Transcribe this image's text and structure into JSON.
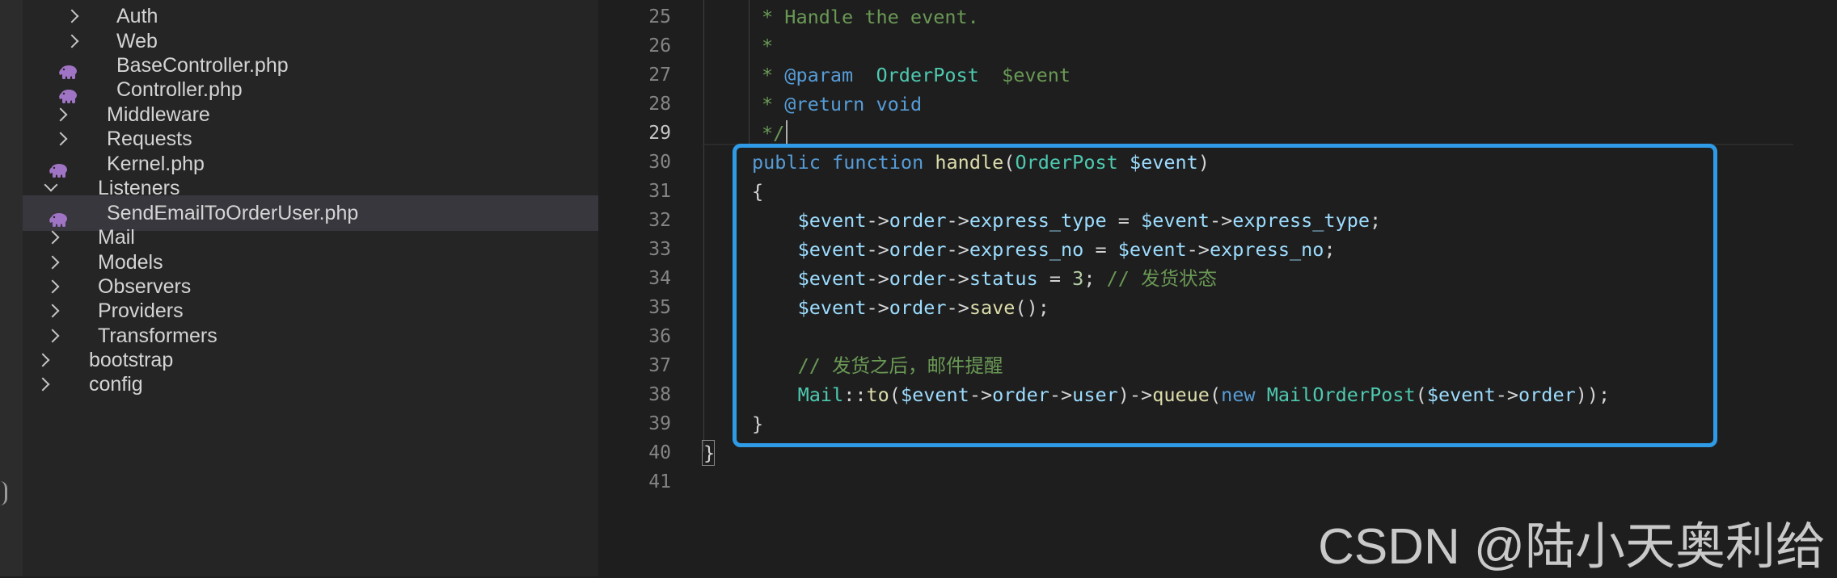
{
  "explorer": {
    "items": [
      {
        "label": "Auth",
        "kind": "folder",
        "state": "closed"
      },
      {
        "label": "Web",
        "kind": "folder",
        "state": "closed"
      },
      {
        "label": "BaseController.php",
        "kind": "php-file"
      },
      {
        "label": "Controller.php",
        "kind": "php-file"
      },
      {
        "label": "Middleware",
        "kind": "folder",
        "state": "closed"
      },
      {
        "label": "Requests",
        "kind": "folder",
        "state": "closed"
      },
      {
        "label": "Kernel.php",
        "kind": "php-file"
      },
      {
        "label": "Listeners",
        "kind": "folder",
        "state": "open"
      },
      {
        "label": "SendEmailToOrderUser.php",
        "kind": "php-file",
        "selected": true
      },
      {
        "label": "Mail",
        "kind": "folder",
        "state": "closed"
      },
      {
        "label": "Models",
        "kind": "folder",
        "state": "closed"
      },
      {
        "label": "Observers",
        "kind": "folder",
        "state": "closed"
      },
      {
        "label": "Providers",
        "kind": "folder",
        "state": "closed"
      },
      {
        "label": "Transformers",
        "kind": "folder",
        "state": "closed"
      },
      {
        "label": "bootstrap",
        "kind": "folder",
        "state": "closed"
      },
      {
        "label": "config",
        "kind": "folder",
        "state": "closed"
      }
    ]
  },
  "editor": {
    "active_line": 29,
    "lines": [
      {
        "no": "25",
        "tokens": [
          [
            "cmt",
            "* Handle the event."
          ]
        ]
      },
      {
        "no": "26",
        "tokens": [
          [
            "cmt",
            "*"
          ]
        ]
      },
      {
        "no": "27",
        "tokens": [
          [
            "cmt",
            "* "
          ],
          [
            "kw",
            "@param"
          ],
          [
            "cmt",
            "  "
          ],
          [
            "cls",
            "OrderPost"
          ],
          [
            "cmt",
            "  "
          ],
          [
            "docvar",
            "$event"
          ]
        ]
      },
      {
        "no": "28",
        "tokens": [
          [
            "cmt",
            "* "
          ],
          [
            "kw",
            "@return"
          ],
          [
            "cmt",
            " "
          ],
          [
            "kw",
            "void"
          ]
        ]
      },
      {
        "no": "29",
        "tokens": [
          [
            "cmt",
            "*/"
          ]
        ]
      },
      {
        "no": "30",
        "tokens": [
          [
            "kw",
            "public"
          ],
          [
            "punct",
            " "
          ],
          [
            "kw",
            "function"
          ],
          [
            "punct",
            " "
          ],
          [
            "fn",
            "handle"
          ],
          [
            "punct",
            "("
          ],
          [
            "cls",
            "OrderPost"
          ],
          [
            "punct",
            " "
          ],
          [
            "var",
            "$event"
          ],
          [
            "punct",
            ")"
          ]
        ]
      },
      {
        "no": "31",
        "tokens": [
          [
            "punct",
            "{"
          ]
        ]
      },
      {
        "no": "32",
        "tokens": [
          [
            "punct",
            "    "
          ],
          [
            "var",
            "$event"
          ],
          [
            "punct",
            "->"
          ],
          [
            "var",
            "order"
          ],
          [
            "punct",
            "->"
          ],
          [
            "var",
            "express_type"
          ],
          [
            "punct",
            " = "
          ],
          [
            "var",
            "$event"
          ],
          [
            "punct",
            "->"
          ],
          [
            "var",
            "express_type"
          ],
          [
            "punct",
            ";"
          ]
        ]
      },
      {
        "no": "33",
        "tokens": [
          [
            "punct",
            "    "
          ],
          [
            "var",
            "$event"
          ],
          [
            "punct",
            "->"
          ],
          [
            "var",
            "order"
          ],
          [
            "punct",
            "->"
          ],
          [
            "var",
            "express_no"
          ],
          [
            "punct",
            " = "
          ],
          [
            "var",
            "$event"
          ],
          [
            "punct",
            "->"
          ],
          [
            "var",
            "express_no"
          ],
          [
            "punct",
            ";"
          ]
        ]
      },
      {
        "no": "34",
        "tokens": [
          [
            "punct",
            "    "
          ],
          [
            "var",
            "$event"
          ],
          [
            "punct",
            "->"
          ],
          [
            "var",
            "order"
          ],
          [
            "punct",
            "->"
          ],
          [
            "var",
            "status"
          ],
          [
            "punct",
            " = "
          ],
          [
            "num",
            "3"
          ],
          [
            "punct",
            "; "
          ],
          [
            "cmt",
            "// 发货状态"
          ]
        ]
      },
      {
        "no": "35",
        "tokens": [
          [
            "punct",
            "    "
          ],
          [
            "var",
            "$event"
          ],
          [
            "punct",
            "->"
          ],
          [
            "var",
            "order"
          ],
          [
            "punct",
            "->"
          ],
          [
            "fn",
            "save"
          ],
          [
            "punct",
            "();"
          ]
        ]
      },
      {
        "no": "36",
        "tokens": []
      },
      {
        "no": "37",
        "tokens": [
          [
            "punct",
            "    "
          ],
          [
            "cmt",
            "// 发货之后，邮件提醒"
          ]
        ]
      },
      {
        "no": "38",
        "tokens": [
          [
            "punct",
            "    "
          ],
          [
            "cls",
            "Mail"
          ],
          [
            "punct",
            "::"
          ],
          [
            "fn",
            "to"
          ],
          [
            "punct",
            "("
          ],
          [
            "var",
            "$event"
          ],
          [
            "punct",
            "->"
          ],
          [
            "var",
            "order"
          ],
          [
            "punct",
            "->"
          ],
          [
            "var",
            "user"
          ],
          [
            "punct",
            ")->"
          ],
          [
            "fn",
            "queue"
          ],
          [
            "punct",
            "("
          ],
          [
            "kw",
            "new"
          ],
          [
            "punct",
            " "
          ],
          [
            "cls",
            "MailOrderPost"
          ],
          [
            "punct",
            "("
          ],
          [
            "var",
            "$event"
          ],
          [
            "punct",
            "->"
          ],
          [
            "var",
            "order"
          ],
          [
            "punct",
            "));"
          ]
        ]
      },
      {
        "no": "39",
        "tokens": [
          [
            "punct",
            "}"
          ]
        ]
      },
      {
        "no": "40",
        "tokens": [
          [
            "punct",
            "}"
          ]
        ]
      },
      {
        "no": "41",
        "tokens": []
      }
    ]
  },
  "watermark": "CSDN @陆小天奥利给",
  "colors": {
    "highlight_border": "#2f9be6",
    "php_icon": "#a074c4"
  }
}
